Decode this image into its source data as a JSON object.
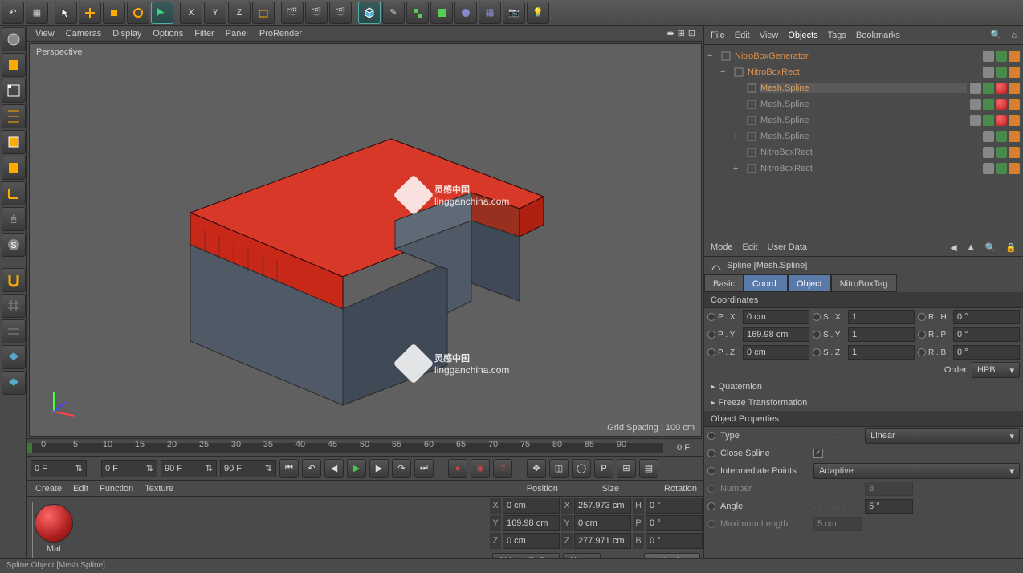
{
  "topbar": {
    "tools": [
      "undo",
      "layout",
      "cursor",
      "move",
      "scale",
      "rotate",
      "live",
      "x-axis",
      "y-axis",
      "z-axis",
      "axis-lock",
      "render-view",
      "render-region",
      "render-settings",
      "cube",
      "pen",
      "array",
      "instance",
      "blob",
      "floor",
      "camera",
      "light"
    ]
  },
  "left_tools": [
    "make-editable",
    "model",
    "point",
    "edge",
    "polygon",
    "texture",
    "workplane",
    "prim1",
    "prim2",
    "axis",
    "snap",
    "snap2",
    "magnet",
    "grid",
    "grid2",
    "prim3",
    "prim4"
  ],
  "viewport": {
    "menu": [
      "View",
      "Cameras",
      "Display",
      "Options",
      "Filter",
      "Panel",
      "ProRender"
    ],
    "label": "Perspective",
    "grid_info": "Grid Spacing : 100 cm",
    "watermark_main": "灵感中国",
    "watermark_sub": "lingganchina.com"
  },
  "timeline": {
    "marks": [
      "0",
      "5",
      "10",
      "15",
      "20",
      "25",
      "30",
      "35",
      "40",
      "45",
      "50",
      "55",
      "60",
      "65",
      "70",
      "75",
      "80",
      "85",
      "90"
    ],
    "end": "0 F"
  },
  "playbar": {
    "f1": "0 F",
    "f2": "0 F",
    "f3": "90 F",
    "f4": "90 F"
  },
  "material": {
    "menu": [
      "Create",
      "Edit",
      "Function",
      "Texture"
    ],
    "name": "Mat"
  },
  "coord_panel": {
    "headers": [
      "Position",
      "Size",
      "Rotation"
    ],
    "rows": [
      {
        "axis": "X",
        "pos": "0 cm",
        "size": "257.973 cm",
        "rlbl": "H",
        "rot": "0 °"
      },
      {
        "axis": "Y",
        "pos": "169.98 cm",
        "size": "0 cm",
        "rlbl": "P",
        "rot": "0 °"
      },
      {
        "axis": "Z",
        "pos": "0 cm",
        "size": "277.971 cm",
        "rlbl": "B",
        "rot": "0 °"
      }
    ],
    "combo1": "Object (Rel)",
    "combo2": "Size",
    "apply": "Apply"
  },
  "objects": {
    "menu": [
      "File",
      "Edit",
      "View",
      "Objects",
      "Tags",
      "Bookmarks"
    ],
    "tree": [
      {
        "indent": 0,
        "name": "NitroBoxGenerator",
        "cls": "orange",
        "exp": "−",
        "tags": [
          "gray",
          "green",
          "orange"
        ]
      },
      {
        "indent": 1,
        "name": "NitroBoxRect",
        "cls": "orange",
        "exp": "−",
        "tags": [
          "gray",
          "green",
          "orange"
        ]
      },
      {
        "indent": 2,
        "name": "Mesh.Spline",
        "cls": "sel",
        "exp": "",
        "tags": [
          "gray",
          "green",
          "red",
          "orange"
        ]
      },
      {
        "indent": 2,
        "name": "Mesh.Spline",
        "cls": "",
        "exp": "",
        "tags": [
          "gray",
          "green",
          "red",
          "orange"
        ]
      },
      {
        "indent": 2,
        "name": "Mesh.Spline",
        "cls": "",
        "exp": "",
        "tags": [
          "gray",
          "green",
          "red",
          "orange"
        ]
      },
      {
        "indent": 2,
        "name": "Mesh.Spline",
        "cls": "",
        "exp": "+",
        "tags": [
          "gray",
          "green",
          "orange"
        ]
      },
      {
        "indent": 2,
        "name": "NitroBoxRect",
        "cls": "",
        "exp": "",
        "tags": [
          "gray",
          "green",
          "orange"
        ]
      },
      {
        "indent": 2,
        "name": "NitroBoxRect",
        "cls": "",
        "exp": "+",
        "tags": [
          "gray",
          "green",
          "orange"
        ]
      }
    ]
  },
  "attributes": {
    "menu": [
      "Mode",
      "Edit",
      "User Data"
    ],
    "title": "Spline [Mesh.Spline]",
    "tabs": [
      "Basic",
      "Coord.",
      "Object",
      "NitroBoxTag"
    ],
    "active_tabs": [
      1,
      2
    ],
    "coords_header": "Coordinates",
    "coords": [
      {
        "p": "P . X",
        "pv": "0 cm",
        "s": "S . X",
        "sv": "1",
        "r": "R . H",
        "rv": "0 °"
      },
      {
        "p": "P . Y",
        "pv": "169.98 cm",
        "s": "S . Y",
        "sv": "1",
        "r": "R . P",
        "rv": "0 °"
      },
      {
        "p": "P . Z",
        "pv": "0 cm",
        "s": "S . Z",
        "sv": "1",
        "r": "R . B",
        "rv": "0 °"
      }
    ],
    "order_label": "Order",
    "order_value": "HPB",
    "expand1": "Quaternion",
    "expand2": "Freeze Transformation",
    "obj_header": "Object Properties",
    "type_label": "Type",
    "type_value": "Linear",
    "close_label": "Close Spline",
    "interp_label": "Intermediate Points",
    "interp_value": "Adaptive",
    "number_label": "Number",
    "number_value": "8",
    "angle_label": "Angle",
    "angle_value": "5 °",
    "maxlen_label": "Maximum Length",
    "maxlen_value": "5 cm"
  },
  "status": "Spline Object [Mesh.Spline]"
}
